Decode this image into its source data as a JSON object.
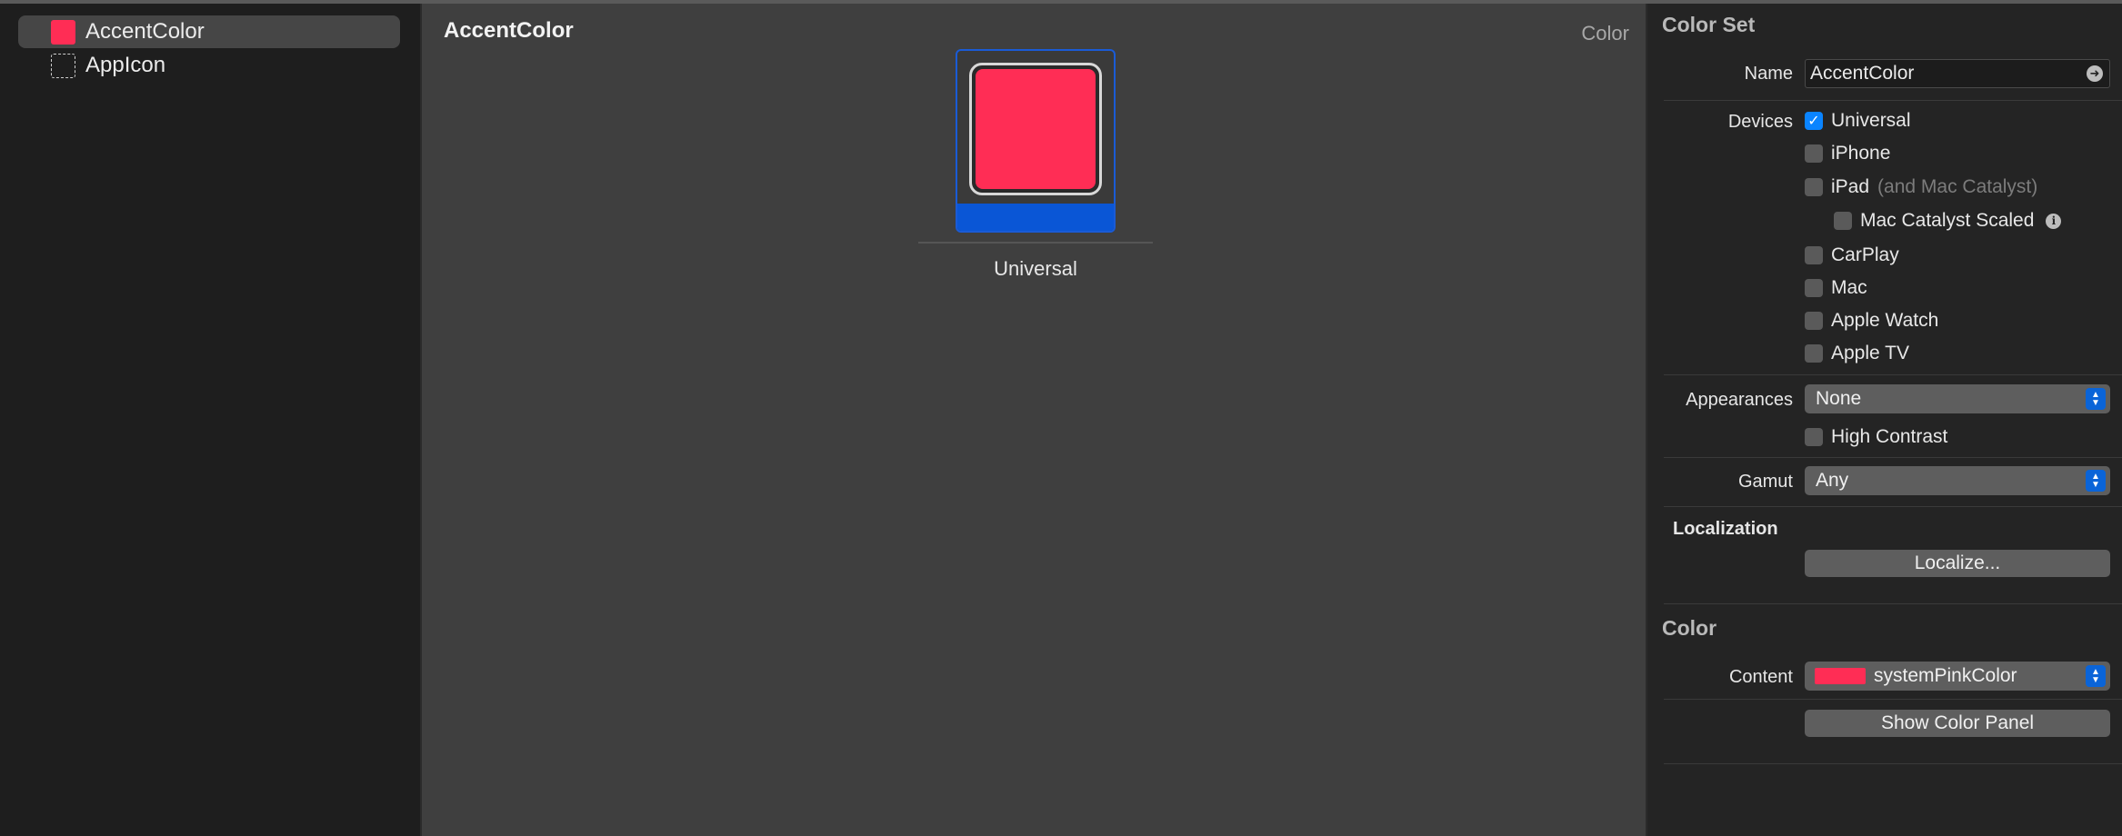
{
  "navigator": {
    "items": [
      {
        "label": "AccentColor",
        "icon": "color-swatch-icon",
        "color": "#ff2d55"
      },
      {
        "label": "AppIcon",
        "icon": "app-icon-placeholder-icon"
      }
    ]
  },
  "editor": {
    "title": "AccentColor",
    "type_label": "Color",
    "well": {
      "label": "Universal",
      "color": "#ff2d55"
    }
  },
  "inspector": {
    "color_set": {
      "title": "Color Set",
      "name_label": "Name",
      "name_value": "AccentColor",
      "devices_label": "Devices",
      "devices": [
        {
          "label": "Universal",
          "checked": true
        },
        {
          "label": "iPhone",
          "checked": false
        },
        {
          "label": "iPad",
          "note": "(and Mac Catalyst)",
          "checked": false
        },
        {
          "label": "Mac Catalyst Scaled",
          "checked": false,
          "has_info": true
        },
        {
          "label": "CarPlay",
          "checked": false
        },
        {
          "label": "Mac",
          "checked": false
        },
        {
          "label": "Apple Watch",
          "checked": false
        },
        {
          "label": "Apple TV",
          "checked": false
        }
      ],
      "appearances_label": "Appearances",
      "appearances_value": "None",
      "high_contrast_label": "High Contrast",
      "high_contrast_checked": false,
      "gamut_label": "Gamut",
      "gamut_value": "Any",
      "localization_title": "Localization",
      "localize_button": "Localize..."
    },
    "color": {
      "title": "Color",
      "content_label": "Content",
      "content_value": "systemPinkColor",
      "content_swatch": "#ff2d55",
      "show_panel_button": "Show Color Panel"
    }
  },
  "colors": {
    "accent": "#ff2d55",
    "selection_blue": "#0a56d6",
    "checkbox_blue": "#0a84ff"
  }
}
